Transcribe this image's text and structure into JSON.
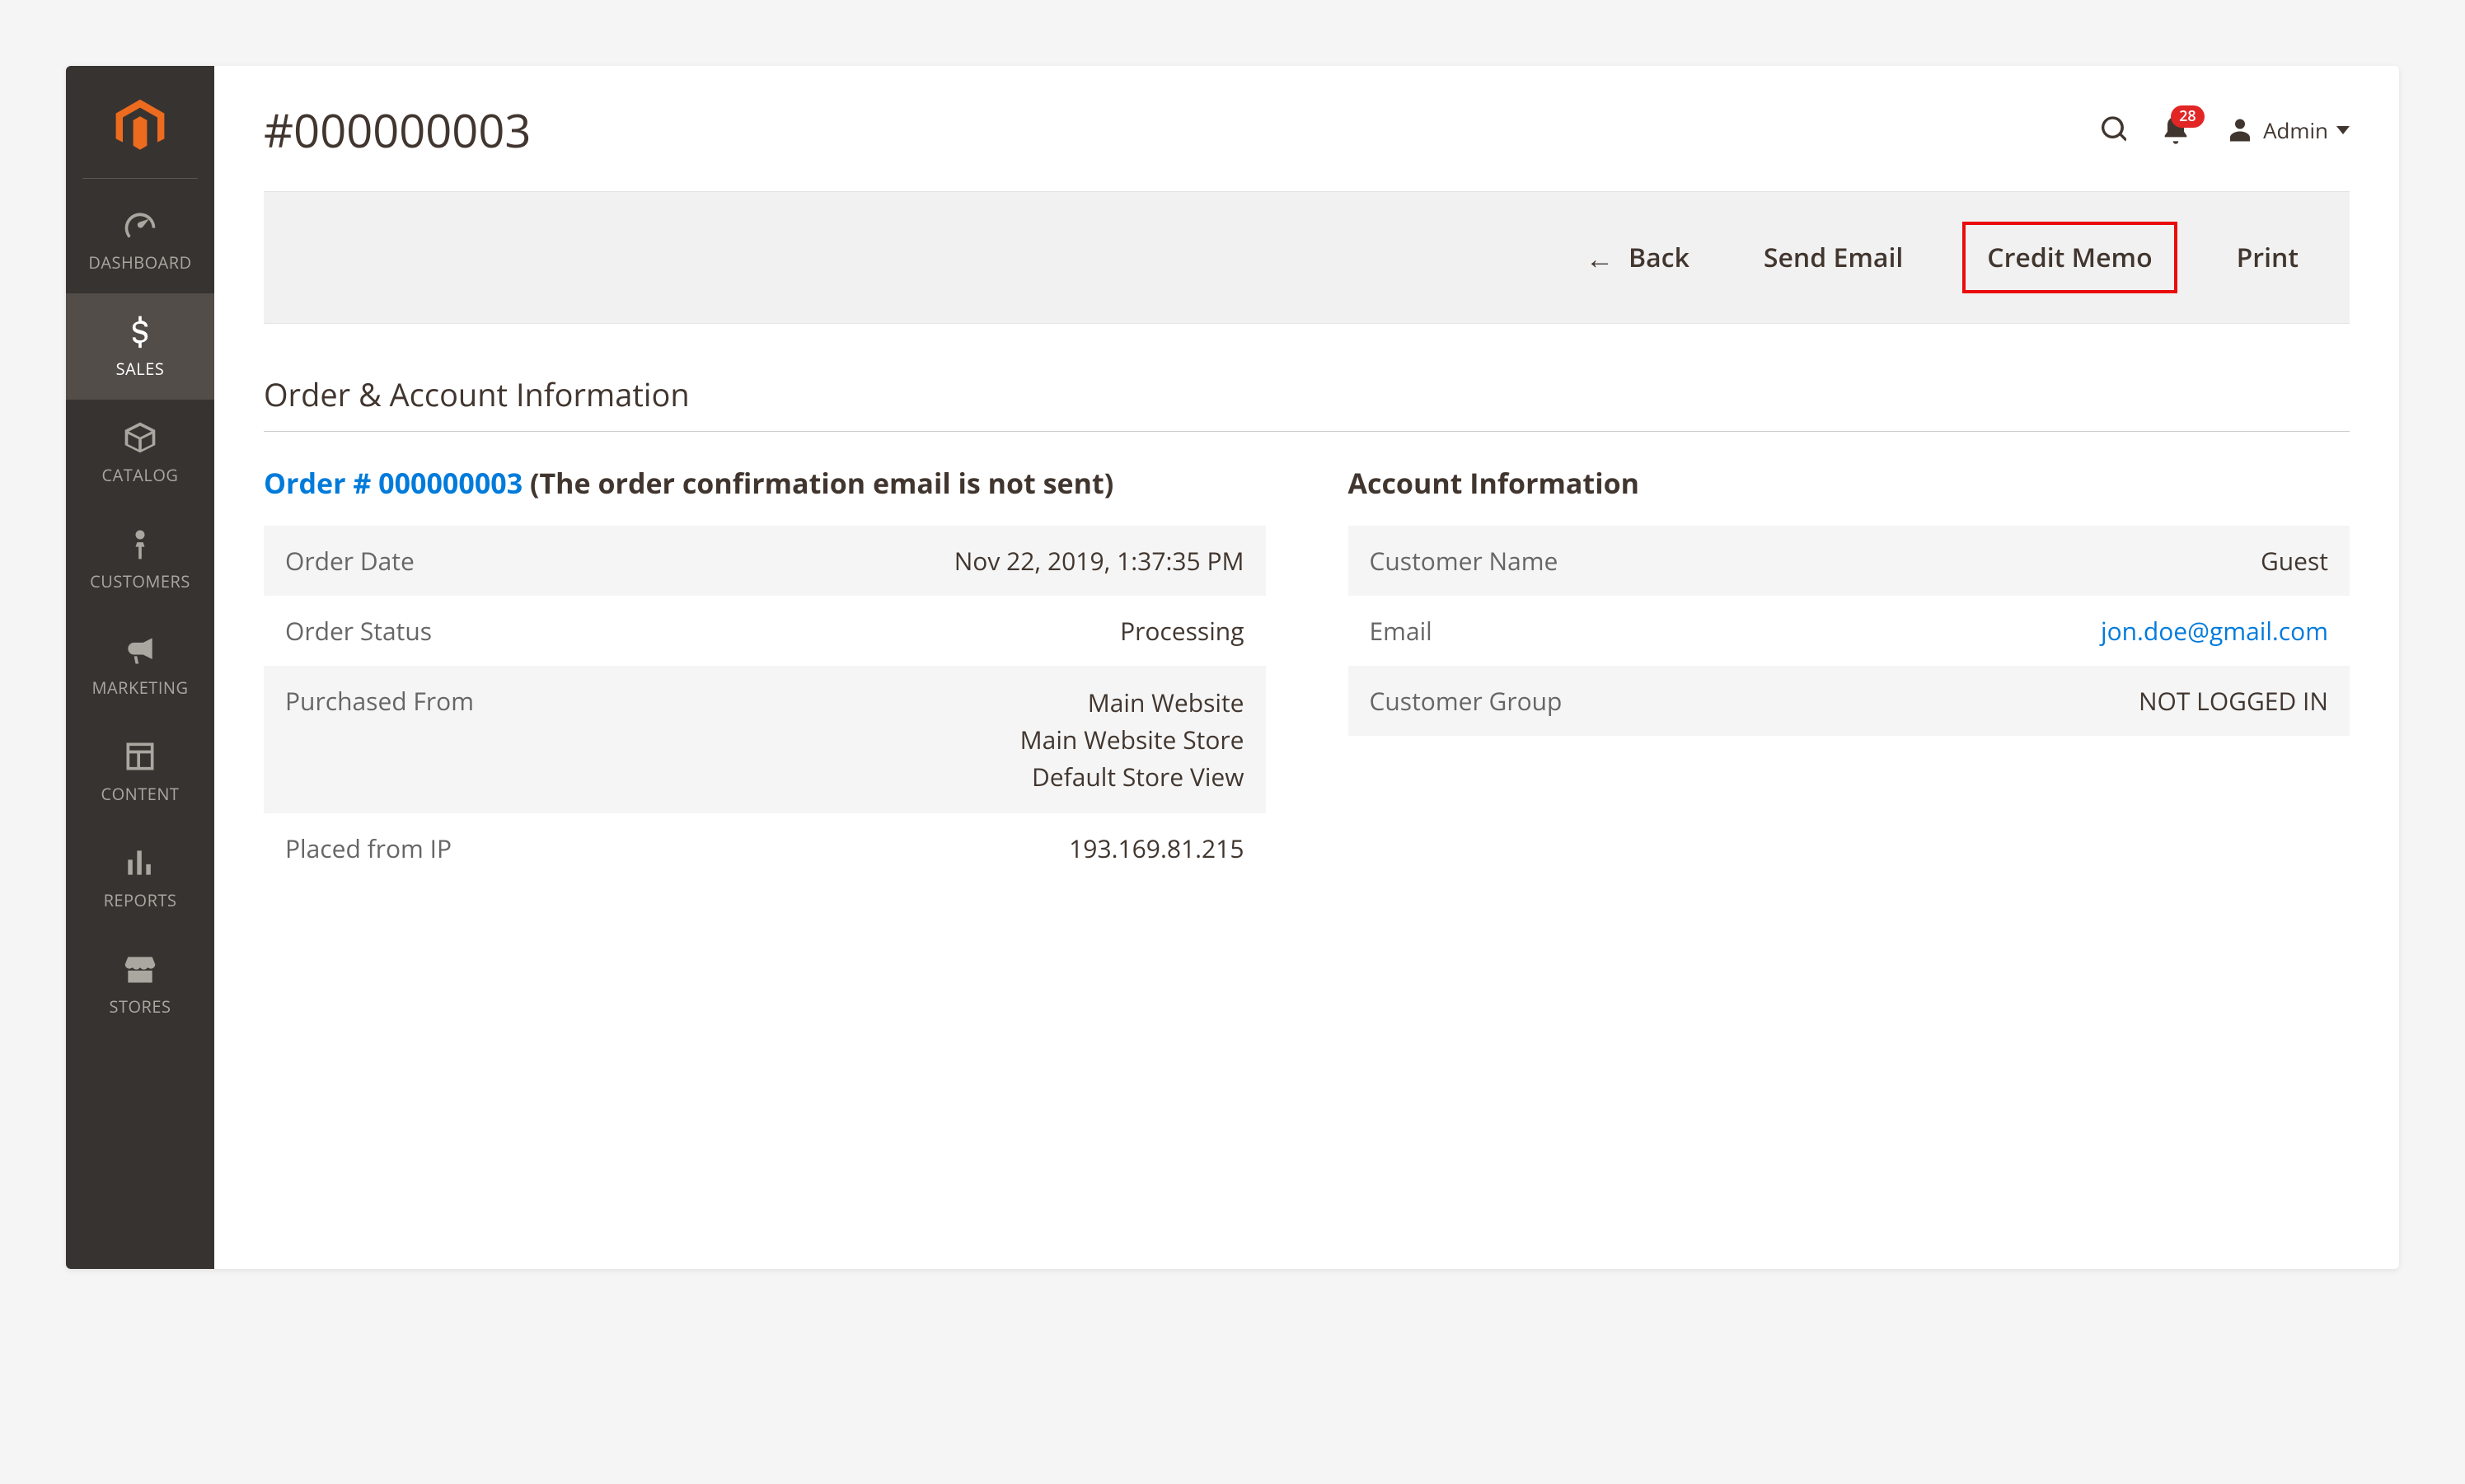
{
  "sidebar": {
    "items": [
      {
        "label": "DASHBOARD"
      },
      {
        "label": "SALES"
      },
      {
        "label": "CATALOG"
      },
      {
        "label": "CUSTOMERS"
      },
      {
        "label": "MARKETING"
      },
      {
        "label": "CONTENT"
      },
      {
        "label": "REPORTS"
      },
      {
        "label": "STORES"
      }
    ]
  },
  "header": {
    "title": "#000000003",
    "notif_count": "28",
    "user_label": "Admin"
  },
  "actions": {
    "back": "Back",
    "send_email": "Send Email",
    "credit_memo": "Credit Memo",
    "print": "Print"
  },
  "section": {
    "title": "Order & Account Information"
  },
  "order": {
    "heading_prefix": "Order # ",
    "order_number": "000000003",
    "heading_suffix": " (The order confirmation email is not sent)",
    "rows": {
      "date_label": "Order Date",
      "date_value": "Nov 22, 2019, 1:37:35 PM",
      "status_label": "Order Status",
      "status_value": "Processing",
      "purchased_label": "Purchased From",
      "purchased_value": "Main Website\nMain Website Store\nDefault Store View",
      "ip_label": "Placed from IP",
      "ip_value": "193.169.81.215"
    }
  },
  "account": {
    "heading": "Account Information",
    "rows": {
      "name_label": "Customer Name",
      "name_value": "Guest",
      "email_label": "Email",
      "email_value": "jon.doe@gmail.com",
      "group_label": "Customer Group",
      "group_value": "NOT LOGGED IN"
    }
  }
}
